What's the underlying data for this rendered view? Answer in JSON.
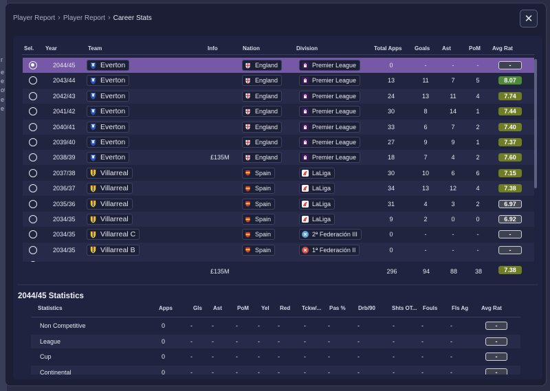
{
  "breadcrumb": [
    "Player Report",
    "Player Report",
    "Career Stats"
  ],
  "close_symbol": "✕",
  "columns": {
    "sel": "Sel.",
    "year": "Year",
    "team": "Team",
    "info": "Info",
    "nation": "Nation",
    "division": "Division",
    "apps": "Total Apps",
    "goals": "Goals",
    "ast": "Ast",
    "pom": "PoM",
    "avg": "Avg Rat"
  },
  "career_rows": [
    {
      "year": "2044/45",
      "team": "Everton",
      "crest": "everton",
      "info": "",
      "nation": "England",
      "division": "Premier League",
      "div_icon": "premier-league",
      "apps": "0",
      "goals": "-",
      "ast": "-",
      "pom": "-",
      "rating": "-",
      "rating_style": "dash",
      "selected": true
    },
    {
      "year": "2043/44",
      "team": "Everton",
      "crest": "everton",
      "info": "",
      "nation": "England",
      "division": "Premier League",
      "div_icon": "premier-league",
      "apps": "13",
      "goals": "11",
      "ast": "7",
      "pom": "5",
      "rating": "8.07",
      "rating_style": "green",
      "selected": false
    },
    {
      "year": "2042/43",
      "team": "Everton",
      "crest": "everton",
      "info": "",
      "nation": "England",
      "division": "Premier League",
      "div_icon": "premier-league",
      "apps": "24",
      "goals": "13",
      "ast": "11",
      "pom": "4",
      "rating": "7.74",
      "rating_style": "olive",
      "selected": false
    },
    {
      "year": "2041/42",
      "team": "Everton",
      "crest": "everton",
      "info": "",
      "nation": "England",
      "division": "Premier League",
      "div_icon": "premier-league",
      "apps": "30",
      "goals": "8",
      "ast": "14",
      "pom": "1",
      "rating": "7.44",
      "rating_style": "olive",
      "selected": false
    },
    {
      "year": "2040/41",
      "team": "Everton",
      "crest": "everton",
      "info": "",
      "nation": "England",
      "division": "Premier League",
      "div_icon": "premier-league",
      "apps": "33",
      "goals": "6",
      "ast": "7",
      "pom": "2",
      "rating": "7.40",
      "rating_style": "olive",
      "selected": false
    },
    {
      "year": "2039/40",
      "team": "Everton",
      "crest": "everton",
      "info": "",
      "nation": "England",
      "division": "Premier League",
      "div_icon": "premier-league",
      "apps": "27",
      "goals": "9",
      "ast": "9",
      "pom": "1",
      "rating": "7.37",
      "rating_style": "olive",
      "selected": false
    },
    {
      "year": "2038/39",
      "team": "Everton",
      "crest": "everton",
      "info": "£135M",
      "nation": "England",
      "division": "Premier League",
      "div_icon": "premier-league",
      "apps": "18",
      "goals": "7",
      "ast": "4",
      "pom": "2",
      "rating": "7.60",
      "rating_style": "olive",
      "selected": false
    },
    {
      "year": "2037/38",
      "team": "Villarreal",
      "crest": "villarreal",
      "info": "",
      "nation": "Spain",
      "division": "LaLiga",
      "div_icon": "laliga",
      "apps": "30",
      "goals": "10",
      "ast": "6",
      "pom": "6",
      "rating": "7.15",
      "rating_style": "olive",
      "selected": false
    },
    {
      "year": "2036/37",
      "team": "Villarreal",
      "crest": "villarreal",
      "info": "",
      "nation": "Spain",
      "division": "LaLiga",
      "div_icon": "laliga",
      "apps": "34",
      "goals": "13",
      "ast": "12",
      "pom": "4",
      "rating": "7.38",
      "rating_style": "olive",
      "selected": false
    },
    {
      "year": "2035/36",
      "team": "Villarreal",
      "crest": "villarreal",
      "info": "",
      "nation": "Spain",
      "division": "LaLiga",
      "div_icon": "laliga",
      "apps": "31",
      "goals": "4",
      "ast": "3",
      "pom": "2",
      "rating": "6.97",
      "rating_style": "grey",
      "selected": false
    },
    {
      "year": "2034/35",
      "team": "Villarreal",
      "crest": "villarreal",
      "info": "",
      "nation": "Spain",
      "division": "LaLiga",
      "div_icon": "laliga",
      "apps": "9",
      "goals": "2",
      "ast": "0",
      "pom": "0",
      "rating": "6.92",
      "rating_style": "grey",
      "selected": false
    },
    {
      "year": "2034/35",
      "team": "Villarreal C",
      "crest": "villarreal",
      "info": "",
      "nation": "Spain",
      "division": "2ª Federación III",
      "div_icon": "federacion-2",
      "apps": "0",
      "goals": "-",
      "ast": "-",
      "pom": "-",
      "rating": "-",
      "rating_style": "dash",
      "selected": false
    },
    {
      "year": "2034/35",
      "team": "Villarreal B",
      "crest": "villarreal",
      "info": "",
      "nation": "Spain",
      "division": "1ª Federación II",
      "div_icon": "federacion-1",
      "apps": "0",
      "goals": "-",
      "ast": "-",
      "pom": "-",
      "rating": "-",
      "rating_style": "dash",
      "selected": false
    }
  ],
  "totals": {
    "info": "£135M",
    "apps": "296",
    "goals": "94",
    "ast": "88",
    "pom": "38",
    "rating": "7.38"
  },
  "season_stats": {
    "title": "2044/45 Statistics",
    "columns": [
      "Statistics",
      "Apps",
      "Gls",
      "Ast",
      "PoM",
      "Yel",
      "Red",
      "Tckw/...",
      "Pas %",
      "Drb/90",
      "Shts OT...",
      "Fouls",
      "Fls Ag",
      "Avg Rat"
    ],
    "rows": [
      {
        "label": "Non Competitive",
        "apps": "0",
        "vals": [
          "-",
          "-",
          "-",
          "-",
          "-",
          "-",
          "-",
          "-",
          "-",
          "-",
          "-"
        ],
        "rating": "-"
      },
      {
        "label": "League",
        "apps": "0",
        "vals": [
          "-",
          "-",
          "-",
          "-",
          "-",
          "-",
          "-",
          "-",
          "-",
          "-",
          "-"
        ],
        "rating": "-"
      },
      {
        "label": "Cup",
        "apps": "0",
        "vals": [
          "-",
          "-",
          "-",
          "-",
          "-",
          "-",
          "-",
          "-",
          "-",
          "-",
          "-"
        ],
        "rating": "-"
      },
      {
        "label": "Continental",
        "apps": "0",
        "vals": [
          "-",
          "-",
          "-",
          "-",
          "-",
          "-",
          "-",
          "-",
          "-",
          "-",
          "-"
        ],
        "rating": "-"
      }
    ]
  }
}
